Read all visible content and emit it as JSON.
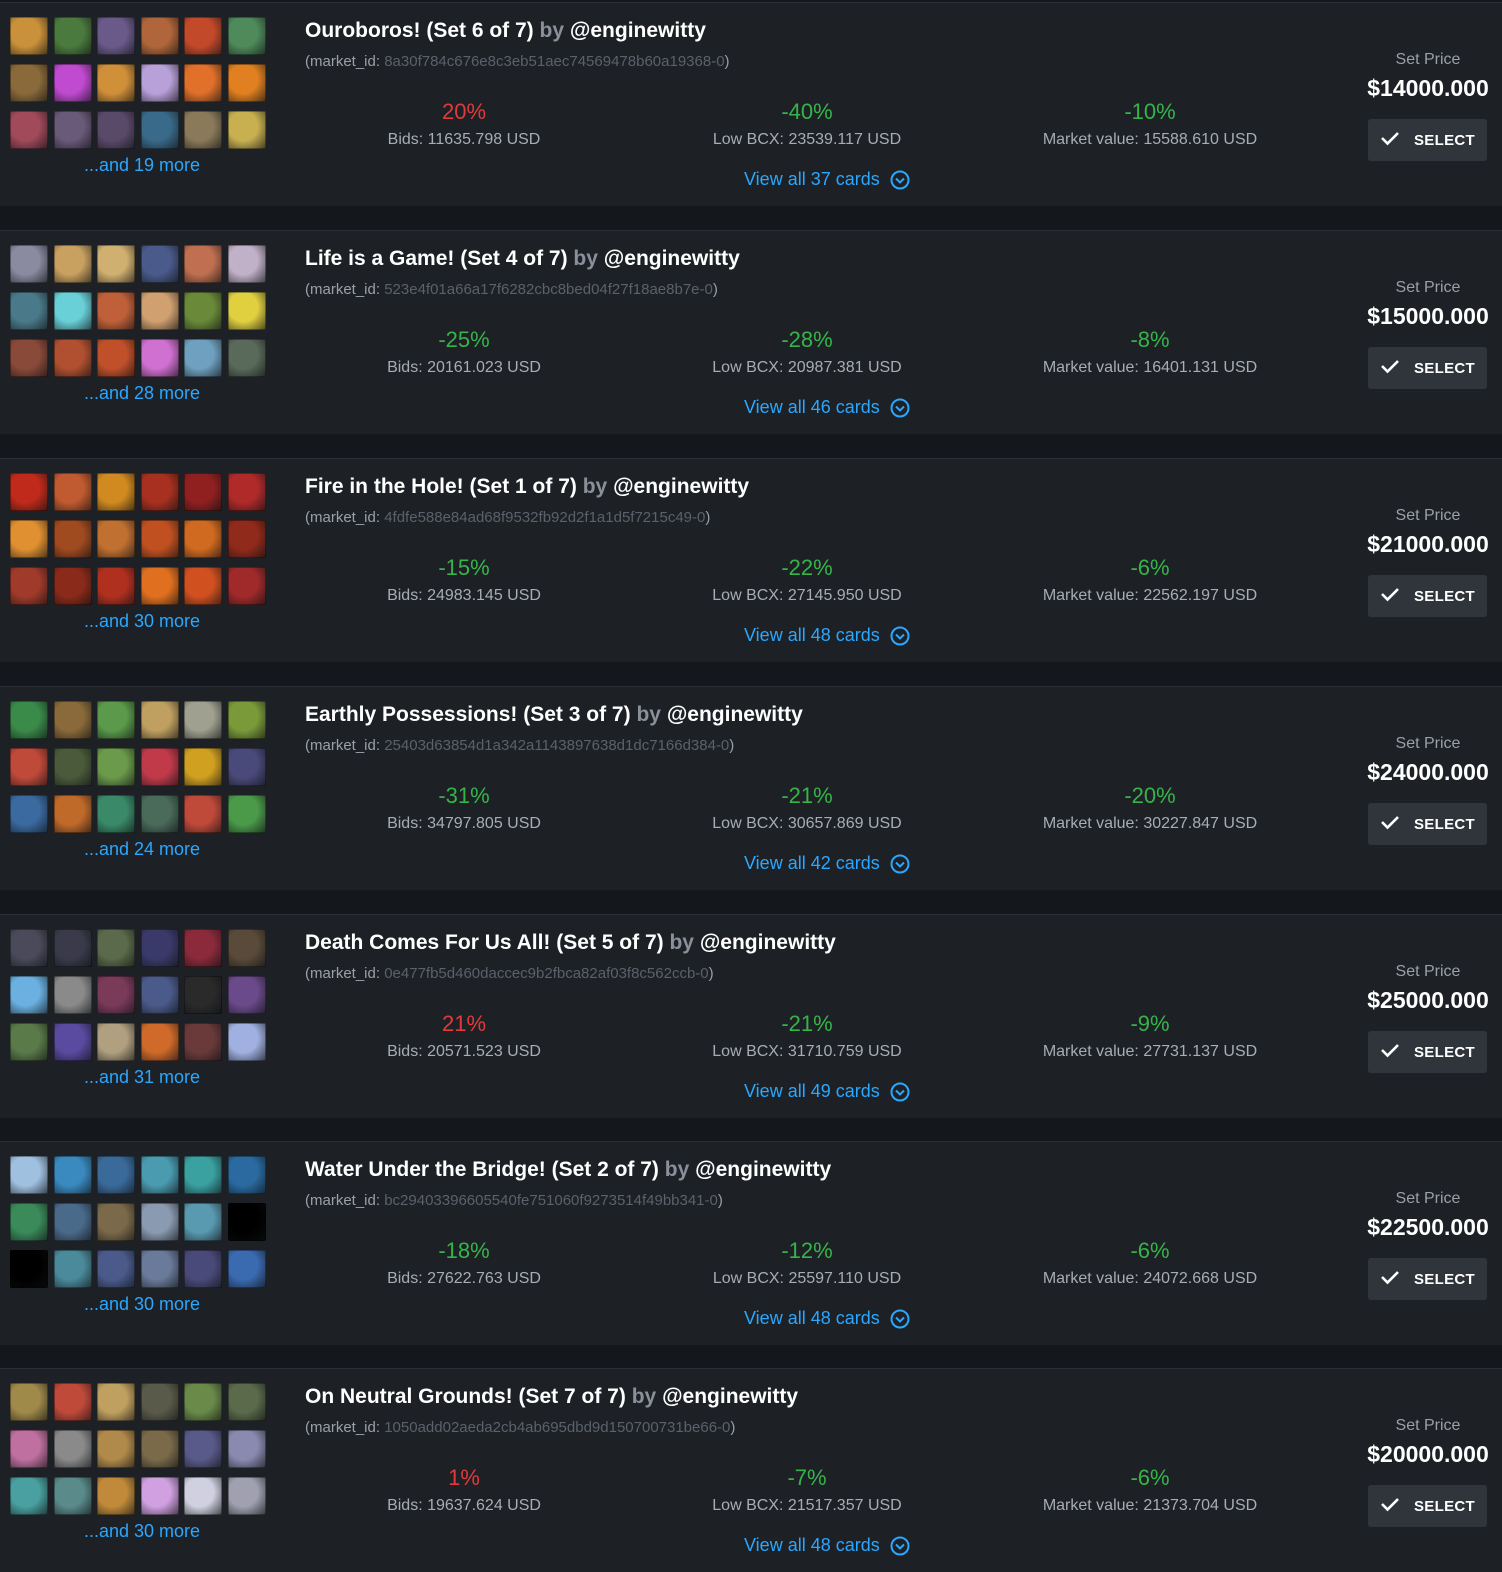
{
  "labels": {
    "market_id_prefix": "(market_id: ",
    "market_id_suffix": ")",
    "by": "by",
    "set_price": "Set Price",
    "select": "SELECT",
    "bids_prefix": "Bids: ",
    "low_bcx_prefix": "Low BCX: ",
    "market_value_prefix": "Market value: "
  },
  "colors": {
    "positive_pct": "#e23a3a",
    "negative_pct": "#36b449",
    "link": "#2aa7ff"
  },
  "sets": [
    {
      "name": "Ouroboros! (Set 6 of 7)",
      "author": "@enginewitty",
      "market_id": "8a30f784c676e8c3eb51aec74569478b60a19368-0",
      "bids_pct": "20%",
      "bids_dir": "pos",
      "bids": "11635.798 USD",
      "low_bcx_pct": "-40%",
      "low_bcx_dir": "neg",
      "low_bcx": "23539.117 USD",
      "market_value_pct": "-10%",
      "market_value_dir": "neg",
      "market_value": "15588.610 USD",
      "view_all": "View all 37 cards",
      "and_more": "...and 19 more",
      "price": "$14000.000",
      "thumb_colors": [
        "#c9913a",
        "#4b7a3e",
        "#6a5a8a",
        "#b0663a",
        "#c24a2a",
        "#4e8a5a",
        "#8a6a3a",
        "#c04ad0",
        "#d0903a",
        "#b8a0d8",
        "#e0702a",
        "#e08020",
        "#a04a5a",
        "#6a5a7a",
        "#5a4a6a",
        "#3a6a8a",
        "#8a7a5a",
        "#c8b050"
      ]
    },
    {
      "name": "Life is a Game! (Set 4 of 7)",
      "author": "@enginewitty",
      "market_id": "523e4f01a66a17f6282cbc8bed04f27f18ae8b7e-0",
      "bids_pct": "-25%",
      "bids_dir": "neg",
      "bids": "20161.023 USD",
      "low_bcx_pct": "-28%",
      "low_bcx_dir": "neg",
      "low_bcx": "20987.381 USD",
      "market_value_pct": "-8%",
      "market_value_dir": "neg",
      "market_value": "16401.131 USD",
      "view_all": "View all 46 cards",
      "and_more": "...and 28 more",
      "price": "$15000.000",
      "thumb_colors": [
        "#8a8aa0",
        "#c8a060",
        "#d0b070",
        "#4a5a8a",
        "#c07050",
        "#c0b0c8",
        "#4a7a8a",
        "#6ad0d8",
        "#c0603a",
        "#d0a070",
        "#6a8a3a",
        "#e0d040",
        "#8a4a3a",
        "#b05030",
        "#c0502a",
        "#d070d0",
        "#70a0c0",
        "#5a6a5a"
      ]
    },
    {
      "name": "Fire in the Hole! (Set 1 of 7)",
      "author": "@enginewitty",
      "market_id": "4fdfe588e84ad68f9532fb92d2f1a1d5f7215c49-0",
      "bids_pct": "-15%",
      "bids_dir": "neg",
      "bids": "24983.145 USD",
      "low_bcx_pct": "-22%",
      "low_bcx_dir": "neg",
      "low_bcx": "27145.950 USD",
      "market_value_pct": "-6%",
      "market_value_dir": "neg",
      "market_value": "22562.197 USD",
      "view_all": "View all 48 cards",
      "and_more": "...and 30 more",
      "price": "$21000.000",
      "thumb_colors": [
        "#c02a1a",
        "#c05a30",
        "#d08a20",
        "#a83020",
        "#902020",
        "#b02a2a",
        "#e09030",
        "#a04a20",
        "#c07030",
        "#c05020",
        "#d06a20",
        "#902a1a",
        "#a03a2a",
        "#8a2a1a",
        "#b03020",
        "#e07020",
        "#d05020",
        "#a02a2a"
      ]
    },
    {
      "name": "Earthly Possessions! (Set 3 of 7)",
      "author": "@enginewitty",
      "market_id": "25403d63854d1a342a1143897638d1dc7166d384-0",
      "bids_pct": "-31%",
      "bids_dir": "neg",
      "bids": "34797.805 USD",
      "low_bcx_pct": "-21%",
      "low_bcx_dir": "neg",
      "low_bcx": "30657.869 USD",
      "market_value_pct": "-20%",
      "market_value_dir": "neg",
      "market_value": "30227.847 USD",
      "view_all": "View all 42 cards",
      "and_more": "...and 24 more",
      "price": "$24000.000",
      "thumb_colors": [
        "#3a8a4a",
        "#8a6a3a",
        "#5a9a4a",
        "#c0a060",
        "#a0a090",
        "#7a9a3a",
        "#c04a3a",
        "#4a5a3a",
        "#6a9a4a",
        "#c03a4a",
        "#d0a020",
        "#4a4a7a",
        "#3a6aa0",
        "#c06a2a",
        "#3a8a6a",
        "#4a6a5a",
        "#c04a3a",
        "#4a9a4a"
      ]
    },
    {
      "name": "Death Comes For Us All! (Set 5 of 7)",
      "author": "@enginewitty",
      "market_id": "0e477fb5d460daccec9b2fbca82af03f8c562ccb-0",
      "bids_pct": "21%",
      "bids_dir": "pos",
      "bids": "20571.523 USD",
      "low_bcx_pct": "-21%",
      "low_bcx_dir": "neg",
      "low_bcx": "31710.759 USD",
      "market_value_pct": "-9%",
      "market_value_dir": "neg",
      "market_value": "27731.137 USD",
      "view_all": "View all 49 cards",
      "and_more": "...and 31 more",
      "price": "$25000.000",
      "thumb_colors": [
        "#4a4a5a",
        "#3a3a4a",
        "#5a6a4a",
        "#3a3a6a",
        "#8a2a3a",
        "#5a4a3a",
        "#6ab0e0",
        "#8a8a8a",
        "#7a3a5a",
        "#4a5a8a",
        "#2a2a2a",
        "#6a4a8a",
        "#5a7a4a",
        "#5a4aa0",
        "#b0a080",
        "#d06a2a",
        "#6a3a3a",
        "#a0b0e0"
      ]
    },
    {
      "name": "Water Under the Bridge! (Set 2 of 7)",
      "author": "@enginewitty",
      "market_id": "bc29403396605540fe751060f9273514f49bb341-0",
      "bids_pct": "-18%",
      "bids_dir": "neg",
      "bids": "27622.763 USD",
      "low_bcx_pct": "-12%",
      "low_bcx_dir": "neg",
      "low_bcx": "25597.110 USD",
      "market_value_pct": "-6%",
      "market_value_dir": "neg",
      "market_value": "24072.668 USD",
      "view_all": "View all 48 cards",
      "and_more": "...and 30 more",
      "price": "$22500.000",
      "thumb_colors": [
        "#a0c0e0",
        "#3a8ac0",
        "#3a6a9a",
        "#4a9ab0",
        "#3aa0a0",
        "#2a6aa0",
        "#3a8a5a",
        "#4a6a8a",
        "#7a6a4a",
        "#8a9ab0",
        "#5a9ab0",
        "#000000",
        "#000000",
        "#4a8a9a",
        "#4a5a8a",
        "#6a7a9a",
        "#4a4a7a",
        "#3a6ab0"
      ]
    },
    {
      "name": "On Neutral Grounds! (Set 7 of 7)",
      "author": "@enginewitty",
      "market_id": "1050add02aeda2cb4ab695dbd9d150700731be66-0",
      "bids_pct": "1%",
      "bids_dir": "pos",
      "bids": "19637.624 USD",
      "low_bcx_pct": "-7%",
      "low_bcx_dir": "neg",
      "low_bcx": "21517.357 USD",
      "market_value_pct": "-6%",
      "market_value_dir": "neg",
      "market_value": "21373.704 USD",
      "view_all": "View all 48 cards",
      "and_more": "...and 30 more",
      "price": "$20000.000",
      "thumb_colors": [
        "#a08a4a",
        "#c04a3a",
        "#c0a060",
        "#5a5a4a",
        "#6a8a4a",
        "#5a6a4a",
        "#c070a0",
        "#8a8a8a",
        "#b08a4a",
        "#7a6a4a",
        "#5a5a8a",
        "#8a8ab0",
        "#4aa0a0",
        "#5a8a8a",
        "#c08a3a",
        "#d0a0e0",
        "#d0d0e0",
        "#a0a0b0"
      ]
    }
  ]
}
